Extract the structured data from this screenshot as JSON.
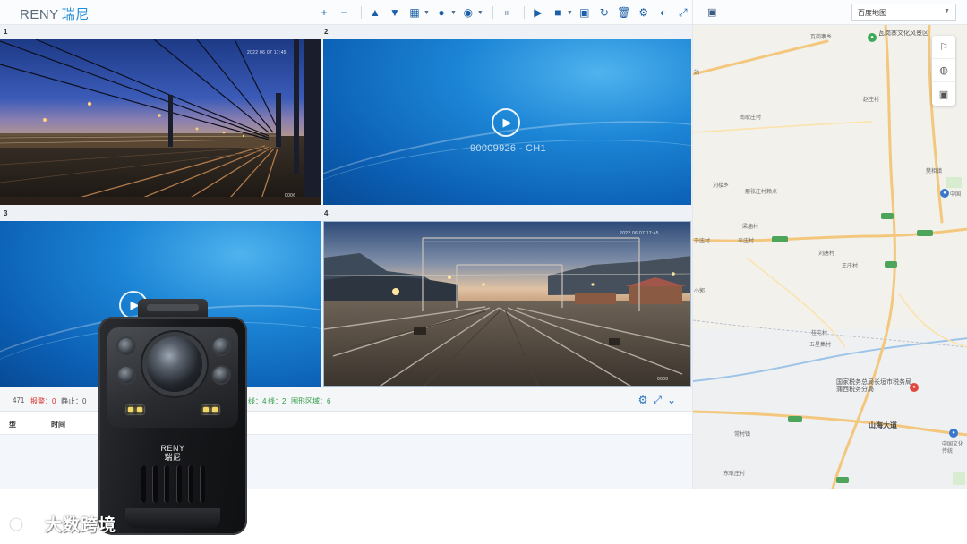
{
  "brand": {
    "name_en": "RENY",
    "name_cn": "瑞尼"
  },
  "toolbar": {
    "buttons": [
      {
        "name": "add-icon",
        "glyph": "+"
      },
      {
        "name": "minus-icon",
        "glyph": "−"
      },
      {
        "name": "up-icon",
        "glyph": "▲"
      },
      {
        "name": "down-icon",
        "glyph": "▼"
      },
      {
        "name": "layout-icon",
        "glyph": "▦"
      },
      {
        "name": "info-icon",
        "glyph": "●"
      },
      {
        "name": "camera-icon",
        "glyph": "◉"
      },
      {
        "name": "pause-icon",
        "glyph": "⏸"
      },
      {
        "name": "play-icon",
        "glyph": "▶"
      },
      {
        "name": "stop-icon",
        "glyph": "■"
      },
      {
        "name": "save-icon",
        "glyph": "▣"
      },
      {
        "name": "refresh-icon",
        "glyph": "↻"
      },
      {
        "name": "delete-icon",
        "glyph": "🗑"
      },
      {
        "name": "settings-icon",
        "glyph": "⚙"
      },
      {
        "name": "palette-icon",
        "glyph": "◐"
      },
      {
        "name": "fullscreen-icon",
        "glyph": "⤢"
      }
    ]
  },
  "video": {
    "cells": [
      {
        "label": "1",
        "device": "",
        "osd": "2022 06 07 17:45",
        "stamp": "0006"
      },
      {
        "label": "2",
        "device": "90009926 - CH1"
      },
      {
        "label": "3",
        "device": ""
      },
      {
        "label": "4",
        "device": "",
        "osd": "2022 06 07 17:45",
        "stamp": "0000"
      }
    ]
  },
  "status": {
    "count": "471",
    "alarm": "报警：0",
    "still": "静止：0",
    "line": "线：4",
    "line2": "线：2",
    "area": "围形区域：6"
  },
  "table": {
    "headers": [
      "型",
      "时间"
    ]
  },
  "map": {
    "type_select": "百度地图",
    "places": [
      {
        "t": "瓦岗寨乡"
      },
      {
        "t": "瓦岗寨文化风景区"
      },
      {
        "t": "站"
      },
      {
        "t": "赵庄村"
      },
      {
        "t": "南耿庄村"
      },
      {
        "t": "樊相镇"
      },
      {
        "t": "刘楼乡"
      },
      {
        "t": "那张庄村赖点"
      },
      {
        "t": "中国"
      },
      {
        "t": "梁庙村"
      },
      {
        "t": "于庄村"
      },
      {
        "t": "辛庄村"
      },
      {
        "t": "刘唐村"
      },
      {
        "t": "王庄村"
      },
      {
        "t": "小郭"
      },
      {
        "t": "桂屯村"
      },
      {
        "t": "五星集村"
      },
      {
        "t": "国家税务总局长垣市税务局蒲西税务分局"
      },
      {
        "t": "山海大道"
      },
      {
        "t": "常村镇"
      },
      {
        "t": "中国文化传统"
      },
      {
        "t": "东耿庄村"
      }
    ],
    "road_shields": [
      "G220",
      "S308",
      "S308",
      "G220",
      "X015"
    ]
  },
  "camera": {
    "brand_en": "RENY",
    "brand_cn": "瑞尼"
  },
  "watermark": {
    "text": "大数跨境"
  }
}
